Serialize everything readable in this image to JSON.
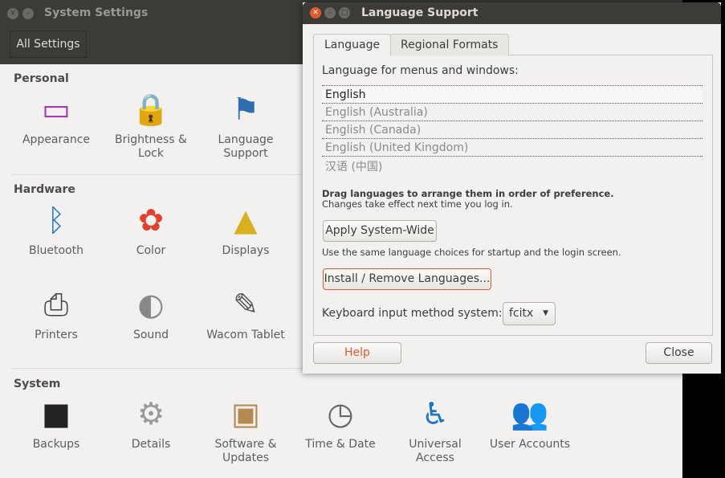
{
  "system_settings": {
    "title": "System Settings",
    "all_settings": "All Settings",
    "sections": [
      {
        "label": "Personal",
        "items": [
          {
            "label": "Appearance",
            "icon": "appearance-icon"
          },
          {
            "label": "Brightness & Lock",
            "icon": "lock-icon"
          },
          {
            "label": "Language Support",
            "icon": "language-flag-icon"
          }
        ]
      },
      {
        "label": "Hardware",
        "items": [
          {
            "label": "Bluetooth",
            "icon": "bluetooth-icon"
          },
          {
            "label": "Color",
            "icon": "color-icon"
          },
          {
            "label": "Displays",
            "icon": "displays-icon"
          },
          {
            "label": "Printers",
            "icon": "printer-icon"
          },
          {
            "label": "Sound",
            "icon": "sound-icon"
          },
          {
            "label": "Wacom Tablet",
            "icon": "tablet-icon"
          }
        ]
      },
      {
        "label": "System",
        "items": [
          {
            "label": "Backups",
            "icon": "safe-icon"
          },
          {
            "label": "Details",
            "icon": "gear-icon"
          },
          {
            "label": "Software & Updates",
            "icon": "package-icon"
          },
          {
            "label": "Time & Date",
            "icon": "clock-icon"
          },
          {
            "label": "Universal Access",
            "icon": "accessibility-icon"
          },
          {
            "label": "User Accounts",
            "icon": "users-icon"
          }
        ]
      }
    ]
  },
  "dialog": {
    "title": "Language Support",
    "tabs": [
      {
        "label": "Language",
        "active": true
      },
      {
        "label": "Regional Formats"
      }
    ],
    "list_label": "Language for menus and windows:",
    "languages": [
      "English",
      "English (Australia)",
      "English (Canada)",
      "English (United Kingdom)",
      "汉语 (中国)"
    ],
    "drag_hint": "Drag languages to arrange them in order of preference.",
    "changes_hint": "Changes take effect next time you log in.",
    "apply_button": "Apply System-Wide",
    "apply_hint": "Use the same language choices for startup and the login screen.",
    "install_button": "Install / Remove Languages...",
    "keyboard_label": "Keyboard input method system:",
    "keyboard_value": "fcitx",
    "help_button": "Help",
    "close_button": "Close",
    "accent": "#e05a2b"
  }
}
